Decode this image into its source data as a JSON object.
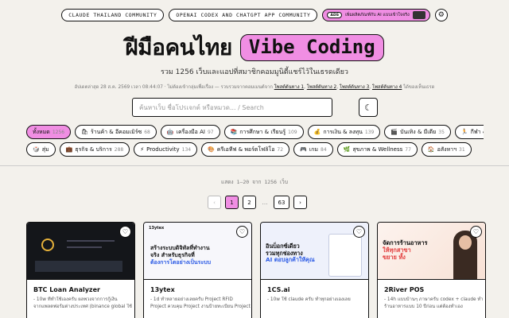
{
  "top": {
    "pill1": "CLAUDE THAILAND COMMUNITY",
    "pill2": "OPENAI CODEX AND CHATGPT APP COMMUNITY",
    "ad_tag": "ADS",
    "ad_text": "เพิ่มผลิตภัณฑ์กับ AI แบบเข้าใจจริง",
    "theme_icon": "gear-icon"
  },
  "hero": {
    "title_thai": "ฝีมือคนไทย",
    "title_vibe": "Vibe Coding",
    "subtitle": "รวม 1256 เว็บและแอปที่สมาชิกคอมมูนิตี้แชร์ไว้ในเธรดเดียว",
    "updated_prefix": "อัปเดตล่าสุด 28 ส.ค. 2569 เวลา 08:44:07 · ไม่ต้องเข้ากลุ่มเพื่อเรื่อง — รวบรวมจากคอมเมนต์จาก",
    "link1": "โพสต์ต้นทาง 1",
    "link2": "โพสต์ต้นทาง 2",
    "link3": "โพสต์ต้นทาง 3",
    "link4": "โพสต์ต้นทาง 4",
    "updated_suffix": "ได้ของเห็นเธรด"
  },
  "search": {
    "placeholder": "ค้นหาเว็บ ชื่อโปรเจกต์ หรือหมวด... / Search"
  },
  "categories_row1": [
    {
      "label": "ทั้งหมด",
      "count": "1256",
      "icon": ""
    },
    {
      "label": "ร้านค้า & อีคอมเมิร์ซ",
      "count": "68",
      "icon": "🛍"
    },
    {
      "label": "เครื่องมือ AI",
      "count": "97",
      "icon": "🤖"
    },
    {
      "label": "การศึกษา & เรียนรู้",
      "count": "109",
      "icon": "📚"
    },
    {
      "label": "การเงิน & ลงทุน",
      "count": "139",
      "icon": "💰"
    },
    {
      "label": "บันเทิง & มีเดีย",
      "count": "35",
      "icon": "🎬"
    },
    {
      "label": "กีฬา & ฟิตเนส",
      "count": "38",
      "icon": "🏃"
    }
  ],
  "categories_row2": [
    {
      "label": "สุ่ม",
      "count": "",
      "icon": "🎲"
    },
    {
      "label": "ธุรกิจ & บริการ",
      "count": "288",
      "icon": "💼"
    },
    {
      "label": "Productivity",
      "count": "134",
      "icon": "⚡"
    },
    {
      "label": "ครีเอทีฟ & พอร์ตโฟลิโอ",
      "count": "72",
      "icon": "🎨"
    },
    {
      "label": "เกม",
      "count": "84",
      "icon": "🎮"
    },
    {
      "label": "สุขภาพ & Wellness",
      "count": "77",
      "icon": "🌿"
    },
    {
      "label": "อสังหาฯ",
      "count": "31",
      "icon": "🏠"
    }
  ],
  "results_text": "แสดง 1–20 จาก 1256 เว็บ",
  "pagination": {
    "prev": "‹",
    "pages": [
      "1",
      "2"
    ],
    "dots": "…",
    "last": "63",
    "next": "›"
  },
  "cards": [
    {
      "title": "BTC Loan Analyzer",
      "desc": "- 10w ที่ทำใช้เองครับ ผลพวงจากการกู้เงิน",
      "desc2": "จากแพลตฟอร์มต่างประเทศ (binance global ใช้"
    },
    {
      "title": "13ytex",
      "desc": "- 1d ทำหลายอย่างเลยครับ Project RFID",
      "desc2": "Project ควบคุม Project งานป้ายทะเบียน Project"
    },
    {
      "title": "1CS.ai",
      "desc": "- 10w ใช้ claude ครับ ทำทุกอย่างเองเลย",
      "desc2": ""
    },
    {
      "title": "2River POS",
      "desc": "- 14h แบบบ้านๆ ภาษาครับ codex + claude ทำ",
      "desc2": "ร้านอาหารแบบ 10 ปีก่อน แต่ต้องทำเอง"
    }
  ],
  "thumb2": {
    "logo": "13ytex",
    "head1": "สร้างระบบดิจิทัลที่ทำงาน",
    "head2": "จริง สำหรับธุรกิจที่",
    "head3": "ต้องการโตอย่างเป็นระบบ"
  },
  "thumb3": {
    "head1": "อินบ็อกซ์เดียว",
    "head2": "รวมทุกช่องทาง",
    "head3": "AI ตอบลูกค้าให้คุณ"
  },
  "thumb4": {
    "head1": "จัดการร้านอาหาร",
    "head2": "ให้ทุกสาขา",
    "head3": "ขยาย ทั้ง"
  }
}
